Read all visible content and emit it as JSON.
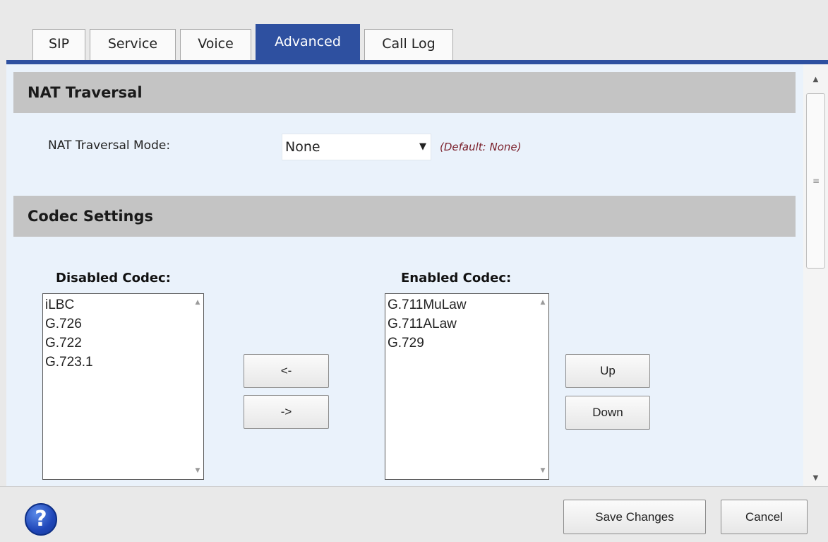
{
  "tabs": [
    {
      "label": "SIP"
    },
    {
      "label": "Service"
    },
    {
      "label": "Voice"
    },
    {
      "label": "Advanced"
    },
    {
      "label": "Call Log"
    }
  ],
  "nat": {
    "header": "NAT Traversal",
    "mode_label": "NAT Traversal Mode:",
    "mode_value": "None",
    "mode_default": "(Default: None)"
  },
  "codec": {
    "header": "Codec Settings",
    "disabled_title": "Disabled Codec:",
    "disabled": [
      "iLBC",
      "G.726",
      "G.722",
      "G.723.1"
    ],
    "enabled_title": "Enabled Codec:",
    "enabled": [
      "G.711MuLaw",
      "G.711ALaw",
      "G.729"
    ],
    "move_left_label": "<-",
    "move_right_label": "->",
    "up_label": "Up",
    "down_label": "Down"
  },
  "footer": {
    "help_symbol": "?",
    "save_label": "Save Changes",
    "cancel_label": "Cancel"
  },
  "colors": {
    "accent": "#2e50a0",
    "note": "#7a1f2a",
    "section_bg": "#c4c4c4",
    "content_bg": "#eaf2fb"
  }
}
